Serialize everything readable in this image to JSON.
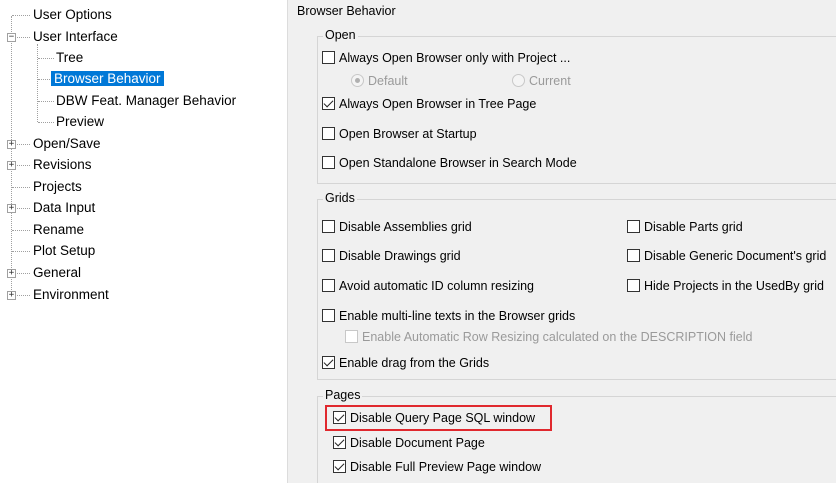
{
  "tree": {
    "items": [
      {
        "label": "User Options",
        "level": 0
      },
      {
        "label": "User Interface",
        "level": 0,
        "expander": "−"
      },
      {
        "label": "Tree",
        "level": 1
      },
      {
        "label": "Browser Behavior",
        "level": 1,
        "selected": true
      },
      {
        "label": "DBW Feat. Manager Behavior",
        "level": 1
      },
      {
        "label": "Preview",
        "level": 1
      },
      {
        "label": "Open/Save",
        "level": 0,
        "expander": "+"
      },
      {
        "label": "Revisions",
        "level": 0,
        "expander": "+"
      },
      {
        "label": "Projects",
        "level": 0
      },
      {
        "label": "Data Input",
        "level": 0,
        "expander": "+"
      },
      {
        "label": "Rename",
        "level": 0
      },
      {
        "label": "Plot Setup",
        "level": 0
      },
      {
        "label": "General",
        "level": 0,
        "expander": "+"
      },
      {
        "label": "Environment",
        "level": 0,
        "expander": "+"
      }
    ]
  },
  "panel": {
    "title": "Browser Behavior",
    "open": {
      "title": "Open",
      "always_open_project": {
        "label": "Always Open Browser only with Project ...",
        "checked": false
      },
      "radio_default": {
        "label": "Default",
        "selected": true
      },
      "radio_current": {
        "label": "Current",
        "selected": false
      },
      "always_open_tree": {
        "label": "Always Open Browser in Tree Page",
        "checked": true
      },
      "open_at_startup": {
        "label": "Open Browser at Startup",
        "checked": false
      },
      "open_standalone": {
        "label": "Open Standalone Browser in Search Mode",
        "checked": false
      }
    },
    "grids": {
      "title": "Grids",
      "disable_assemblies": {
        "label": "Disable Assemblies grid",
        "checked": false
      },
      "disable_parts": {
        "label": "Disable Parts grid",
        "checked": false
      },
      "disable_drawings": {
        "label": "Disable Drawings grid",
        "checked": false
      },
      "disable_generic": {
        "label": "Disable Generic Document's grid",
        "checked": false
      },
      "avoid_id_resize": {
        "label": "Avoid automatic ID column resizing",
        "checked": false
      },
      "hide_projects": {
        "label": "Hide Projects in the UsedBy grid",
        "checked": false
      },
      "multiline": {
        "label": "Enable multi-line texts in the Browser grids",
        "checked": false
      },
      "auto_row_resize": {
        "label": "Enable Automatic Row Resizing calculated on the DESCRIPTION field",
        "checked": false
      },
      "enable_drag": {
        "label": "Enable drag from the Grids",
        "checked": true
      }
    },
    "pages": {
      "title": "Pages",
      "disable_query_sql": {
        "label": "Disable Query Page SQL window",
        "checked": true
      },
      "disable_document": {
        "label": "Disable Document Page",
        "checked": true
      },
      "disable_full_preview": {
        "label": "Disable Full Preview Page window",
        "checked": true
      }
    }
  },
  "colors": {
    "selection": "#0078d7",
    "highlight": "#e0282e",
    "panel_bg": "#f0f0f0"
  }
}
